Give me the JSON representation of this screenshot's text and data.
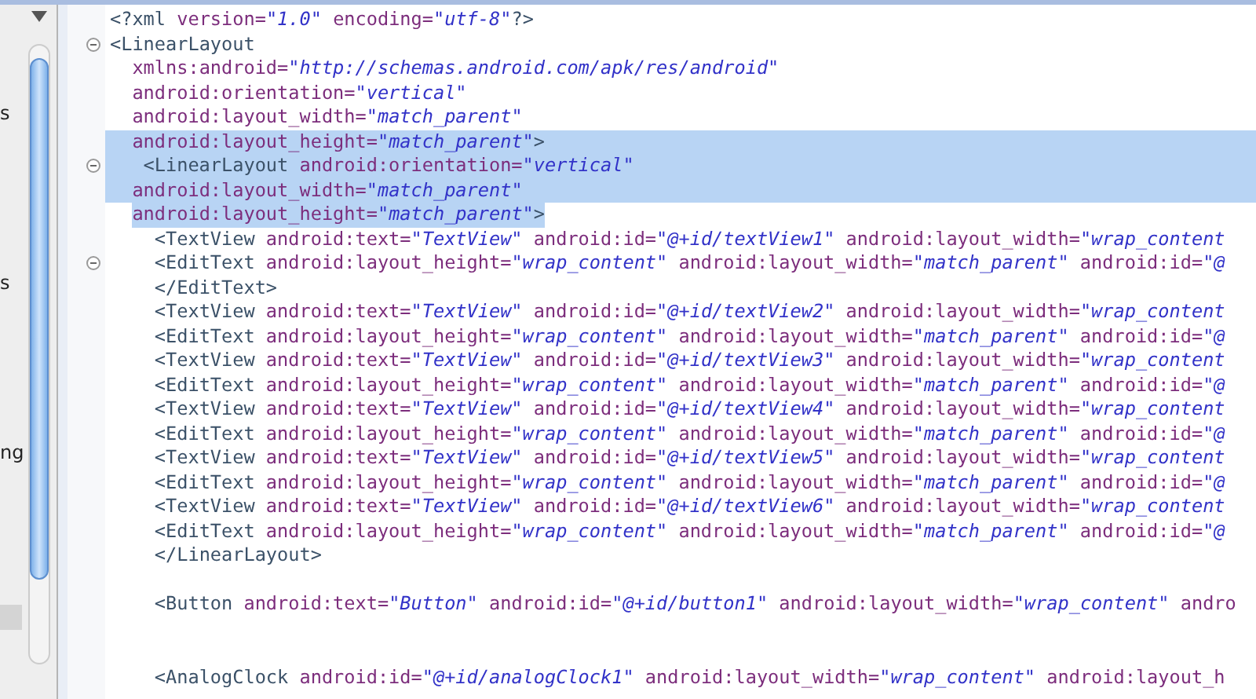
{
  "sidebar": {
    "items": [
      {
        "label": "s"
      },
      {
        "label": "s"
      },
      {
        "label": "ng"
      }
    ]
  },
  "editor": {
    "lines": [
      {
        "kind": "root",
        "foldable": false,
        "selected": false,
        "tokens": [
          {
            "kind": "tag",
            "t": "<?xml "
          },
          {
            "kind": "attr",
            "t": "version="
          },
          {
            "kind": "value",
            "t": "\"1.0\""
          },
          {
            "kind": "attr",
            "t": " encoding="
          },
          {
            "kind": "value",
            "t": "\"utf-8\""
          },
          {
            "kind": "tag",
            "t": "?>"
          }
        ]
      },
      {
        "kind": "root",
        "foldable": true,
        "selected": false,
        "tokens": [
          {
            "kind": "tag",
            "t": "<LinearLayout"
          }
        ]
      },
      {
        "kind": "attr",
        "foldable": false,
        "selected": false,
        "tokens": [
          {
            "kind": "attr",
            "t": "xmlns:android="
          },
          {
            "kind": "value",
            "t": "\"http://schemas.android.com/apk/res/android\""
          }
        ]
      },
      {
        "kind": "attr",
        "foldable": false,
        "selected": false,
        "tokens": [
          {
            "kind": "attr",
            "t": "android:orientation="
          },
          {
            "kind": "value",
            "t": "\"vertical\""
          }
        ]
      },
      {
        "kind": "attr",
        "foldable": false,
        "selected": false,
        "tokens": [
          {
            "kind": "attr",
            "t": "android:layout_width="
          },
          {
            "kind": "value",
            "t": "\"match_parent\""
          }
        ]
      },
      {
        "kind": "attr",
        "foldable": false,
        "selected": true,
        "tokens": [
          {
            "kind": "attr",
            "t": "android:layout_height="
          },
          {
            "kind": "value",
            "t": "\"match_parent\""
          },
          {
            "kind": "tag",
            "t": ">"
          }
        ]
      },
      {
        "kind": "nested",
        "foldable": true,
        "selected": true,
        "tokens": [
          {
            "kind": "tag",
            "t": "<LinearLayout"
          },
          {
            "kind": "attr",
            "t": " android:orientation="
          },
          {
            "kind": "value",
            "t": "\"vertical\""
          }
        ]
      },
      {
        "kind": "attr",
        "foldable": false,
        "selected": true,
        "tokens": [
          {
            "kind": "attr",
            "t": "android:layout_width="
          },
          {
            "kind": "value",
            "t": "\"match_parent\""
          }
        ]
      },
      {
        "kind": "attr",
        "foldable": false,
        "selected": true,
        "tokens": [
          {
            "kind": "attr",
            "t": "android:layout_height="
          },
          {
            "kind": "value",
            "t": "\"match_parent\""
          },
          {
            "kind": "tag",
            "t": ">"
          }
        ]
      },
      {
        "kind": "child",
        "foldable": false,
        "selected": false,
        "tokens": [
          {
            "kind": "tag",
            "t": "<TextView"
          },
          {
            "kind": "attr",
            "t": " android:text="
          },
          {
            "kind": "value",
            "t": "\"TextView\""
          },
          {
            "kind": "attr",
            "t": " android:id="
          },
          {
            "kind": "value",
            "t": "\"@+id/textView1\""
          },
          {
            "kind": "attr",
            "t": " android:layout_width="
          },
          {
            "kind": "value",
            "t": "\"wrap_content"
          }
        ]
      },
      {
        "kind": "child",
        "foldable": true,
        "selected": false,
        "tokens": [
          {
            "kind": "tag",
            "t": "<EditText"
          },
          {
            "kind": "attr",
            "t": " android:layout_height="
          },
          {
            "kind": "value",
            "t": "\"wrap_content\""
          },
          {
            "kind": "attr",
            "t": " android:layout_width="
          },
          {
            "kind": "value",
            "t": "\"match_parent\""
          },
          {
            "kind": "attr",
            "t": " android:id="
          },
          {
            "kind": "value",
            "t": "\"@"
          }
        ]
      },
      {
        "kind": "child",
        "foldable": false,
        "selected": false,
        "tokens": [
          {
            "kind": "tag",
            "t": "</EditText>"
          }
        ]
      },
      {
        "kind": "child",
        "foldable": false,
        "selected": false,
        "tokens": [
          {
            "kind": "tag",
            "t": "<TextView"
          },
          {
            "kind": "attr",
            "t": " android:text="
          },
          {
            "kind": "value",
            "t": "\"TextView\""
          },
          {
            "kind": "attr",
            "t": " android:id="
          },
          {
            "kind": "value",
            "t": "\"@+id/textView2\""
          },
          {
            "kind": "attr",
            "t": " android:layout_width="
          },
          {
            "kind": "value",
            "t": "\"wrap_content"
          }
        ]
      },
      {
        "kind": "child",
        "foldable": false,
        "selected": false,
        "tokens": [
          {
            "kind": "tag",
            "t": "<EditText"
          },
          {
            "kind": "attr",
            "t": " android:layout_height="
          },
          {
            "kind": "value",
            "t": "\"wrap_content\""
          },
          {
            "kind": "attr",
            "t": " android:layout_width="
          },
          {
            "kind": "value",
            "t": "\"match_parent\""
          },
          {
            "kind": "attr",
            "t": " android:id="
          },
          {
            "kind": "value",
            "t": "\"@"
          }
        ]
      },
      {
        "kind": "child",
        "foldable": false,
        "selected": false,
        "tokens": [
          {
            "kind": "tag",
            "t": "<TextView"
          },
          {
            "kind": "attr",
            "t": " android:text="
          },
          {
            "kind": "value",
            "t": "\"TextView\""
          },
          {
            "kind": "attr",
            "t": " android:id="
          },
          {
            "kind": "value",
            "t": "\"@+id/textView3\""
          },
          {
            "kind": "attr",
            "t": " android:layout_width="
          },
          {
            "kind": "value",
            "t": "\"wrap_content"
          }
        ]
      },
      {
        "kind": "child",
        "foldable": false,
        "selected": false,
        "tokens": [
          {
            "kind": "tag",
            "t": "<EditText"
          },
          {
            "kind": "attr",
            "t": " android:layout_height="
          },
          {
            "kind": "value",
            "t": "\"wrap_content\""
          },
          {
            "kind": "attr",
            "t": " android:layout_width="
          },
          {
            "kind": "value",
            "t": "\"match_parent\""
          },
          {
            "kind": "attr",
            "t": " android:id="
          },
          {
            "kind": "value",
            "t": "\"@"
          }
        ]
      },
      {
        "kind": "child",
        "foldable": false,
        "selected": false,
        "tokens": [
          {
            "kind": "tag",
            "t": "<TextView"
          },
          {
            "kind": "attr",
            "t": " android:text="
          },
          {
            "kind": "value",
            "t": "\"TextView\""
          },
          {
            "kind": "attr",
            "t": " android:id="
          },
          {
            "kind": "value",
            "t": "\"@+id/textView4\""
          },
          {
            "kind": "attr",
            "t": " android:layout_width="
          },
          {
            "kind": "value",
            "t": "\"wrap_content"
          }
        ]
      },
      {
        "kind": "child",
        "foldable": false,
        "selected": false,
        "tokens": [
          {
            "kind": "tag",
            "t": "<EditText"
          },
          {
            "kind": "attr",
            "t": " android:layout_height="
          },
          {
            "kind": "value",
            "t": "\"wrap_content\""
          },
          {
            "kind": "attr",
            "t": " android:layout_width="
          },
          {
            "kind": "value",
            "t": "\"match_parent\""
          },
          {
            "kind": "attr",
            "t": " android:id="
          },
          {
            "kind": "value",
            "t": "\"@"
          }
        ]
      },
      {
        "kind": "child",
        "foldable": false,
        "selected": false,
        "tokens": [
          {
            "kind": "tag",
            "t": "<TextView"
          },
          {
            "kind": "attr",
            "t": " android:text="
          },
          {
            "kind": "value",
            "t": "\"TextView\""
          },
          {
            "kind": "attr",
            "t": " android:id="
          },
          {
            "kind": "value",
            "t": "\"@+id/textView5\""
          },
          {
            "kind": "attr",
            "t": " android:layout_width="
          },
          {
            "kind": "value",
            "t": "\"wrap_content"
          }
        ]
      },
      {
        "kind": "child",
        "foldable": false,
        "selected": false,
        "tokens": [
          {
            "kind": "tag",
            "t": "<EditText"
          },
          {
            "kind": "attr",
            "t": " android:layout_height="
          },
          {
            "kind": "value",
            "t": "\"wrap_content\""
          },
          {
            "kind": "attr",
            "t": " android:layout_width="
          },
          {
            "kind": "value",
            "t": "\"match_parent\""
          },
          {
            "kind": "attr",
            "t": " android:id="
          },
          {
            "kind": "value",
            "t": "\"@"
          }
        ]
      },
      {
        "kind": "child",
        "foldable": false,
        "selected": false,
        "tokens": [
          {
            "kind": "tag",
            "t": "<TextView"
          },
          {
            "kind": "attr",
            "t": " android:text="
          },
          {
            "kind": "value",
            "t": "\"TextView\""
          },
          {
            "kind": "attr",
            "t": " android:id="
          },
          {
            "kind": "value",
            "t": "\"@+id/textView6\""
          },
          {
            "kind": "attr",
            "t": " android:layout_width="
          },
          {
            "kind": "value",
            "t": "\"wrap_content"
          }
        ]
      },
      {
        "kind": "child",
        "foldable": false,
        "selected": false,
        "tokens": [
          {
            "kind": "tag",
            "t": "<EditText"
          },
          {
            "kind": "attr",
            "t": " android:layout_height="
          },
          {
            "kind": "value",
            "t": "\"wrap_content\""
          },
          {
            "kind": "attr",
            "t": " android:layout_width="
          },
          {
            "kind": "value",
            "t": "\"match_parent\""
          },
          {
            "kind": "attr",
            "t": " android:id="
          },
          {
            "kind": "value",
            "t": "\"@"
          }
        ]
      },
      {
        "kind": "child",
        "foldable": false,
        "selected": false,
        "tokens": [
          {
            "kind": "tag",
            "t": "</LinearLayout>"
          }
        ]
      },
      {
        "kind": "spaced",
        "foldable": false,
        "selected": false,
        "tokens": [
          {
            "kind": "tag",
            "t": "<Button"
          },
          {
            "kind": "attr",
            "t": " android:text="
          },
          {
            "kind": "value",
            "t": "\"Button\""
          },
          {
            "kind": "attr",
            "t": " android:id="
          },
          {
            "kind": "value",
            "t": "\"@+id/button1\""
          },
          {
            "kind": "attr",
            "t": " android:layout_width="
          },
          {
            "kind": "value",
            "t": "\"wrap_content\""
          },
          {
            "kind": "attr",
            "t": " andro"
          }
        ]
      },
      {
        "kind": "spaced_wide",
        "foldable": false,
        "selected": false,
        "tokens": [
          {
            "kind": "tag",
            "t": "<AnalogClock"
          },
          {
            "kind": "attr",
            "t": " android:id="
          },
          {
            "kind": "value",
            "t": "\"@+id/analogClock1\""
          },
          {
            "kind": "attr",
            "t": " android:layout_width="
          },
          {
            "kind": "value",
            "t": "\"wrap_content\""
          },
          {
            "kind": "attr",
            "t": " android:layout_h"
          }
        ]
      }
    ]
  }
}
